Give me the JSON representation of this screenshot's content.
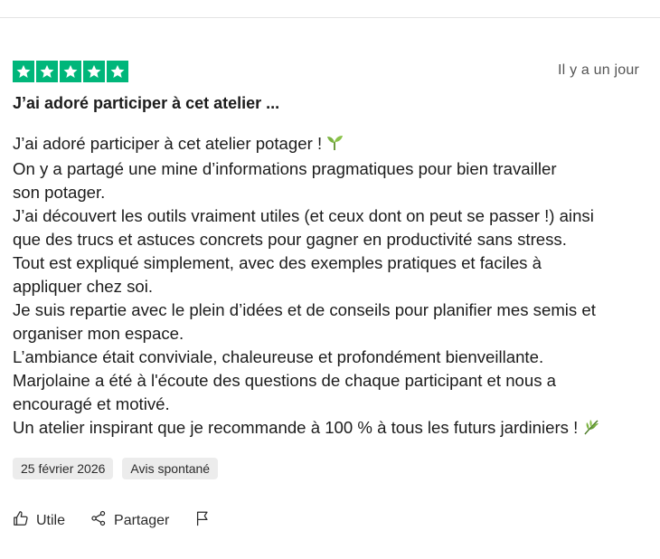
{
  "review": {
    "rating": 5,
    "rating_max": 5,
    "star_color": "#00b67a",
    "relative_date": "Il y a un jour",
    "title": "J’ai adoré participer à cet atelier ...",
    "body_lines": [
      "J’ai adoré participer à cet atelier potager !",
      "On y a partagé une mine d’informations pragmatiques pour bien travailler",
      "son potager.",
      "J’ai découvert les outils vraiment utiles (et ceux dont on peut se passer !) ainsi",
      "que des trucs et astuces concrets pour gagner en productivité sans stress.",
      "Tout est expliqué simplement, avec des exemples pratiques et faciles à",
      "appliquer chez soi.",
      "Je suis repartie avec le plein d’idées et de conseils pour planifier mes semis et",
      "organiser mon espace.",
      "L’ambiance était conviviale, chaleureuse et profondément bienveillante.",
      "Marjolaine a été à l'écoute des questions de chaque participant et nous a",
      "encouragé et motivé.",
      "Un atelier inspirant que je recommande à 100 % à tous les futurs jardiniers !"
    ],
    "tags": {
      "date": "25 février 2026",
      "type": "Avis spontané"
    }
  },
  "actions": {
    "useful_label": "Utile",
    "share_label": "Partager",
    "useful_icon": "thumbs-up-icon",
    "share_icon": "share-icon",
    "report_icon": "flag-icon"
  }
}
